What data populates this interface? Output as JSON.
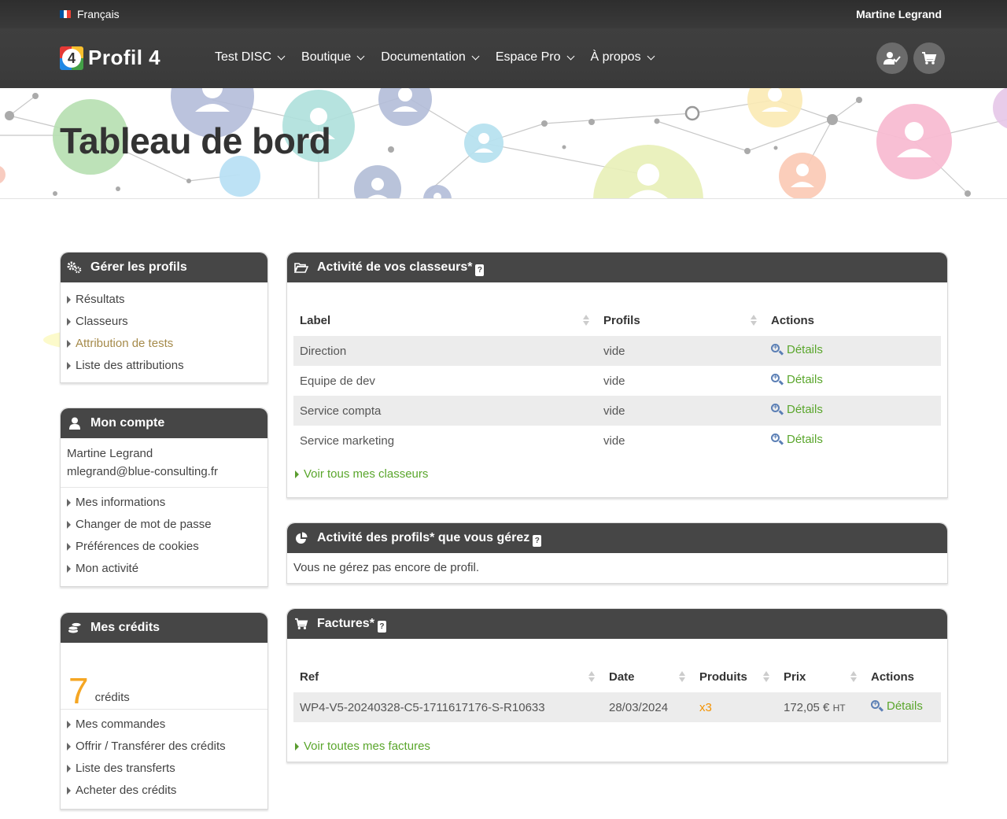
{
  "topbar": {
    "language": "Français",
    "user_name": "Martine Legrand",
    "flag_colors": [
      "#0055a4",
      "#ffffff",
      "#ef4135"
    ]
  },
  "nav": {
    "logo_text": "Profil 4",
    "logo_digit": "4",
    "items": [
      {
        "label": "Test DISC"
      },
      {
        "label": "Boutique"
      },
      {
        "label": "Documentation"
      },
      {
        "label": "Espace Pro"
      },
      {
        "label": "À propos"
      }
    ],
    "account_icon": "user-check-icon",
    "cart_icon": "cart-icon"
  },
  "banner": {
    "title": "Tableau de bord"
  },
  "sidebar": {
    "profiles": {
      "title": "Gérer les profils",
      "icon": "gears-icon",
      "links": [
        "Résultats",
        "Classeurs",
        "Attribution de tests",
        "Liste des attributions"
      ]
    },
    "account": {
      "title": "Mon compte",
      "icon": "user-icon",
      "name": "Martine Legrand",
      "email": "mlegrand@blue-consulting.fr",
      "links": [
        "Mes informations",
        "Changer de mot de passe",
        "Préférences de cookies",
        "Mon activité"
      ]
    },
    "credits": {
      "title": "Mes crédits",
      "icon": "coins-icon",
      "amount": "7",
      "unit": "crédits",
      "links": [
        "Mes commandes",
        "Offrir / Transférer des crédits",
        "Liste des transferts",
        "Acheter des crédits"
      ]
    }
  },
  "binders": {
    "title": "Activité de vos classeurs*",
    "icon": "folder-open-icon",
    "columns": [
      "Label",
      "Profils",
      "Actions"
    ],
    "rows": [
      {
        "label": "Direction",
        "profiles": "vide",
        "action": "Détails"
      },
      {
        "label": "Equipe de dev",
        "profiles": "vide",
        "action": "Détails"
      },
      {
        "label": "Service compta",
        "profiles": "vide",
        "action": "Détails"
      },
      {
        "label": "Service marketing",
        "profiles": "vide",
        "action": "Détails"
      }
    ],
    "footer_link": "Voir tous mes classeurs"
  },
  "managed_profiles": {
    "title": "Activité des profils* que vous gérez",
    "icon": "pie-chart-icon",
    "message": "Vous ne gérez pas encore de profil."
  },
  "invoices": {
    "title": "Factures*",
    "icon": "cart-icon",
    "columns": [
      "Ref",
      "Date",
      "Produits",
      "Prix",
      "Actions"
    ],
    "rows": [
      {
        "ref": "WP4-V5-20240328-C5-1711617176-S-R10633",
        "date": "28/03/2024",
        "products": "x3",
        "price": "172,05 €",
        "price_suffix": "HT",
        "action": "Détails"
      }
    ],
    "footer_link": "Voir toutes mes factures"
  },
  "colors": {
    "dark": "#464646",
    "link_green": "#5aa62c",
    "credit_orange": "#f5a623"
  }
}
